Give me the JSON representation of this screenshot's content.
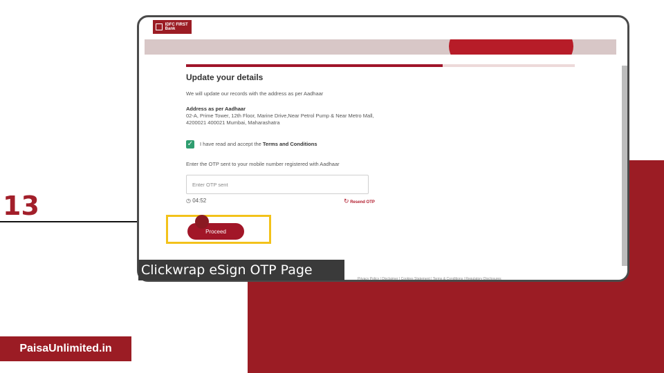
{
  "step_number": "13",
  "brand": {
    "logo_text": "IDFC FIRST\nBank",
    "accent": "#9b1c24"
  },
  "progress": {
    "fraction": 0.66
  },
  "form": {
    "title": "Update your details",
    "subtitle": "We will update our records with the address as per Aadhaar",
    "address_label": "Address as per Aadhaar",
    "address_value": "02-A, Prime Tower, 12th Floor, Marine Drive,Near Petrol Pump & Near Metro Mall, 4200021 400021 Mumbai, Maharashatra",
    "checkbox_checked": true,
    "terms_prefix": "I have read and accept the ",
    "terms_link": "Terms and Conditions",
    "otp_instruction": "Enter the OTP sent to your mobile number registered with Aadhaar",
    "otp_placeholder": "Enter OTP sent",
    "otp_value": "",
    "timer": "04:52",
    "resend_label": "Resend OTP",
    "proceed_label": "Proceed"
  },
  "footer_links": "Privacy Policy  |  Disclaimer  |  Cookies Statement  |  Terms & Conditions  |  Regulatory Disclosures",
  "caption": "Clickwrap eSign OTP Page",
  "site_label": "PaisaUnlimited.in",
  "icons": {
    "timer": "clock-icon",
    "resend": "refresh-icon",
    "checkbox": "check-icon"
  }
}
